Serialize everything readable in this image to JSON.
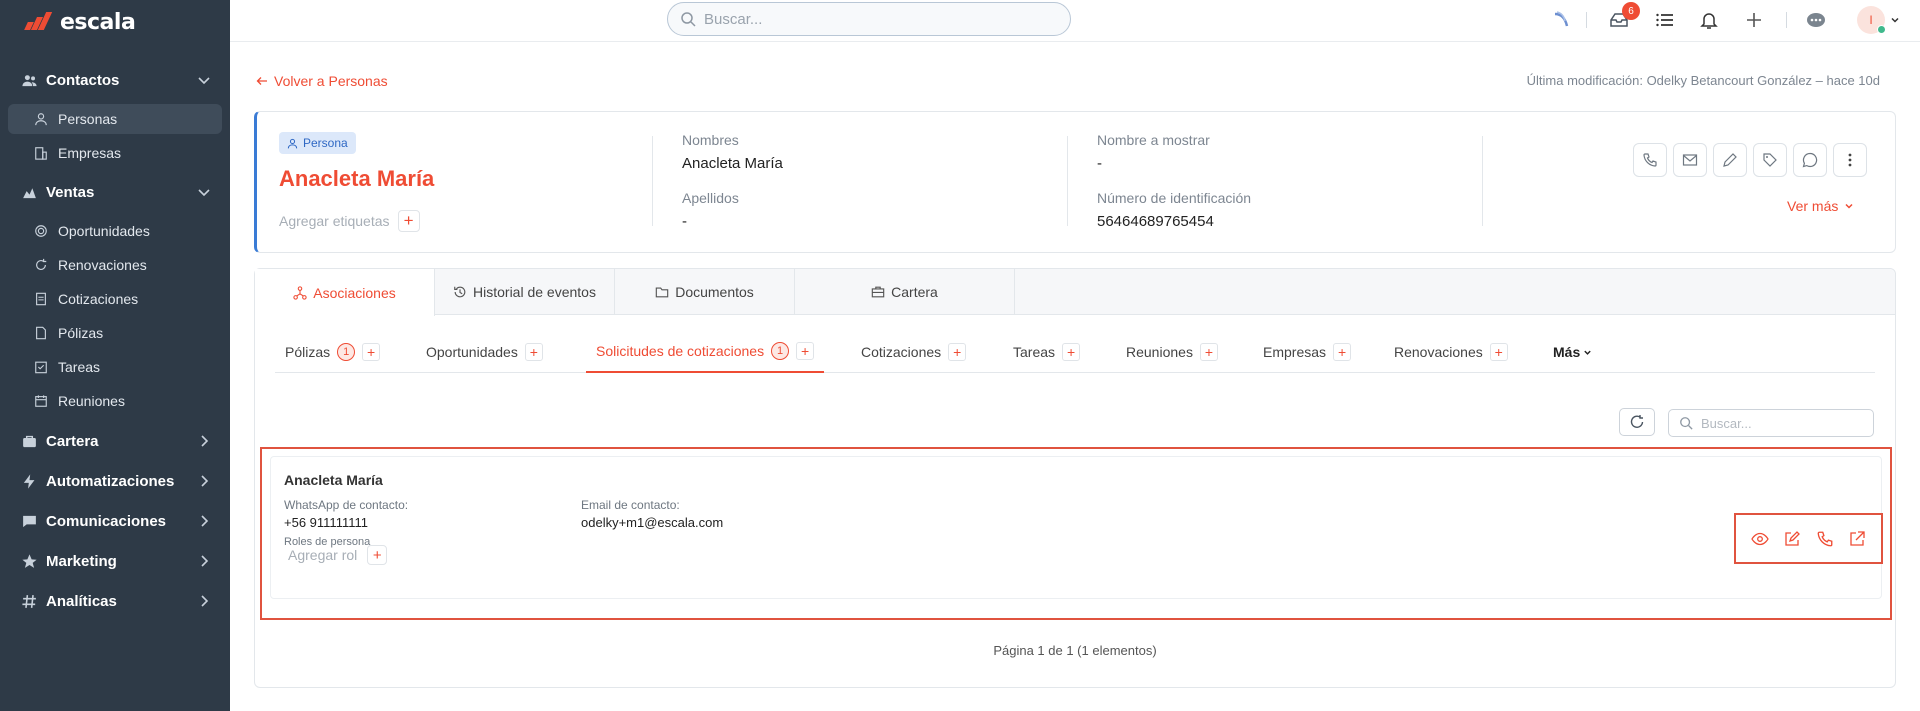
{
  "brand": {
    "name": "escala"
  },
  "sidebar": {
    "sections": [
      {
        "label": "Contactos",
        "icon": "users-icon",
        "expanded": true
      },
      {
        "label": "Ventas",
        "icon": "ventas-icon",
        "expanded": true
      },
      {
        "label": "Cartera",
        "icon": "cartera-icon",
        "expanded": false
      },
      {
        "label": "Automatizaciones",
        "icon": "bolt-icon",
        "expanded": false
      },
      {
        "label": "Comunicaciones",
        "icon": "chat-icon",
        "expanded": false
      },
      {
        "label": "Marketing",
        "icon": "star-icon",
        "expanded": false
      },
      {
        "label": "Analíticas",
        "icon": "hash-icon",
        "expanded": false
      }
    ],
    "contactos_items": [
      {
        "label": "Personas",
        "icon": "person-icon",
        "active": true
      },
      {
        "label": "Empresas",
        "icon": "building-icon",
        "active": false
      }
    ],
    "ventas_items": [
      {
        "label": "Oportunidades",
        "icon": "target-icon"
      },
      {
        "label": "Renovaciones",
        "icon": "refresh-icon"
      },
      {
        "label": "Cotizaciones",
        "icon": "document-icon"
      },
      {
        "label": "Pólizas",
        "icon": "file-icon"
      },
      {
        "label": "Tareas",
        "icon": "checklist-icon"
      },
      {
        "label": "Reuniones",
        "icon": "calendar-icon"
      }
    ]
  },
  "topbar": {
    "search_placeholder": "Buscar...",
    "notifications_count": "6",
    "avatar_initial": "I"
  },
  "page": {
    "back_label": "Volver a Personas",
    "last_modified": "Última modificación: Odelky Betancourt González – hace 10d"
  },
  "person": {
    "badge": "Persona",
    "name": "Anacleta María",
    "add_tags_label": "Agregar etiquetas",
    "nombres_label": "Nombres",
    "nombres_value": "Anacleta María",
    "apellidos_label": "Apellidos",
    "apellidos_value": "-",
    "display_name_label": "Nombre a mostrar",
    "display_name_value": "-",
    "id_label": "Número de identificación",
    "id_value": "56464689765454",
    "ver_mas": "Ver más"
  },
  "tabs": [
    {
      "label": "Asociaciones",
      "active": true
    },
    {
      "label": "Historial de eventos",
      "active": false
    },
    {
      "label": "Documentos",
      "active": false
    },
    {
      "label": "Cartera",
      "active": false
    }
  ],
  "subtabs": [
    {
      "label": "Pólizas",
      "count": "1"
    },
    {
      "label": "Oportunidades",
      "count": ""
    },
    {
      "label": "Solicitudes de cotizaciones",
      "count": "1"
    },
    {
      "label": "Cotizaciones",
      "count": ""
    },
    {
      "label": "Tareas",
      "count": ""
    },
    {
      "label": "Reuniones",
      "count": ""
    },
    {
      "label": "Empresas",
      "count": ""
    },
    {
      "label": "Renovaciones",
      "count": ""
    }
  ],
  "more_label": "Más",
  "list": {
    "search_placeholder": "Buscar...",
    "record": {
      "name": "Anacleta María",
      "whatsapp_label": "WhatsApp de contacto:",
      "whatsapp_value": "+56 911111111",
      "email_label": "Email de contacto:",
      "email_value": "odelky+m1@escala.com",
      "roles_label": "Roles de persona",
      "add_role_label": "Agregar rol"
    },
    "pagination": "Página 1 de 1 (1 elementos)"
  },
  "colors": {
    "accent": "#ef4c34",
    "sidebar": "#2e3a47",
    "persona_badge": "#dce8fa"
  }
}
